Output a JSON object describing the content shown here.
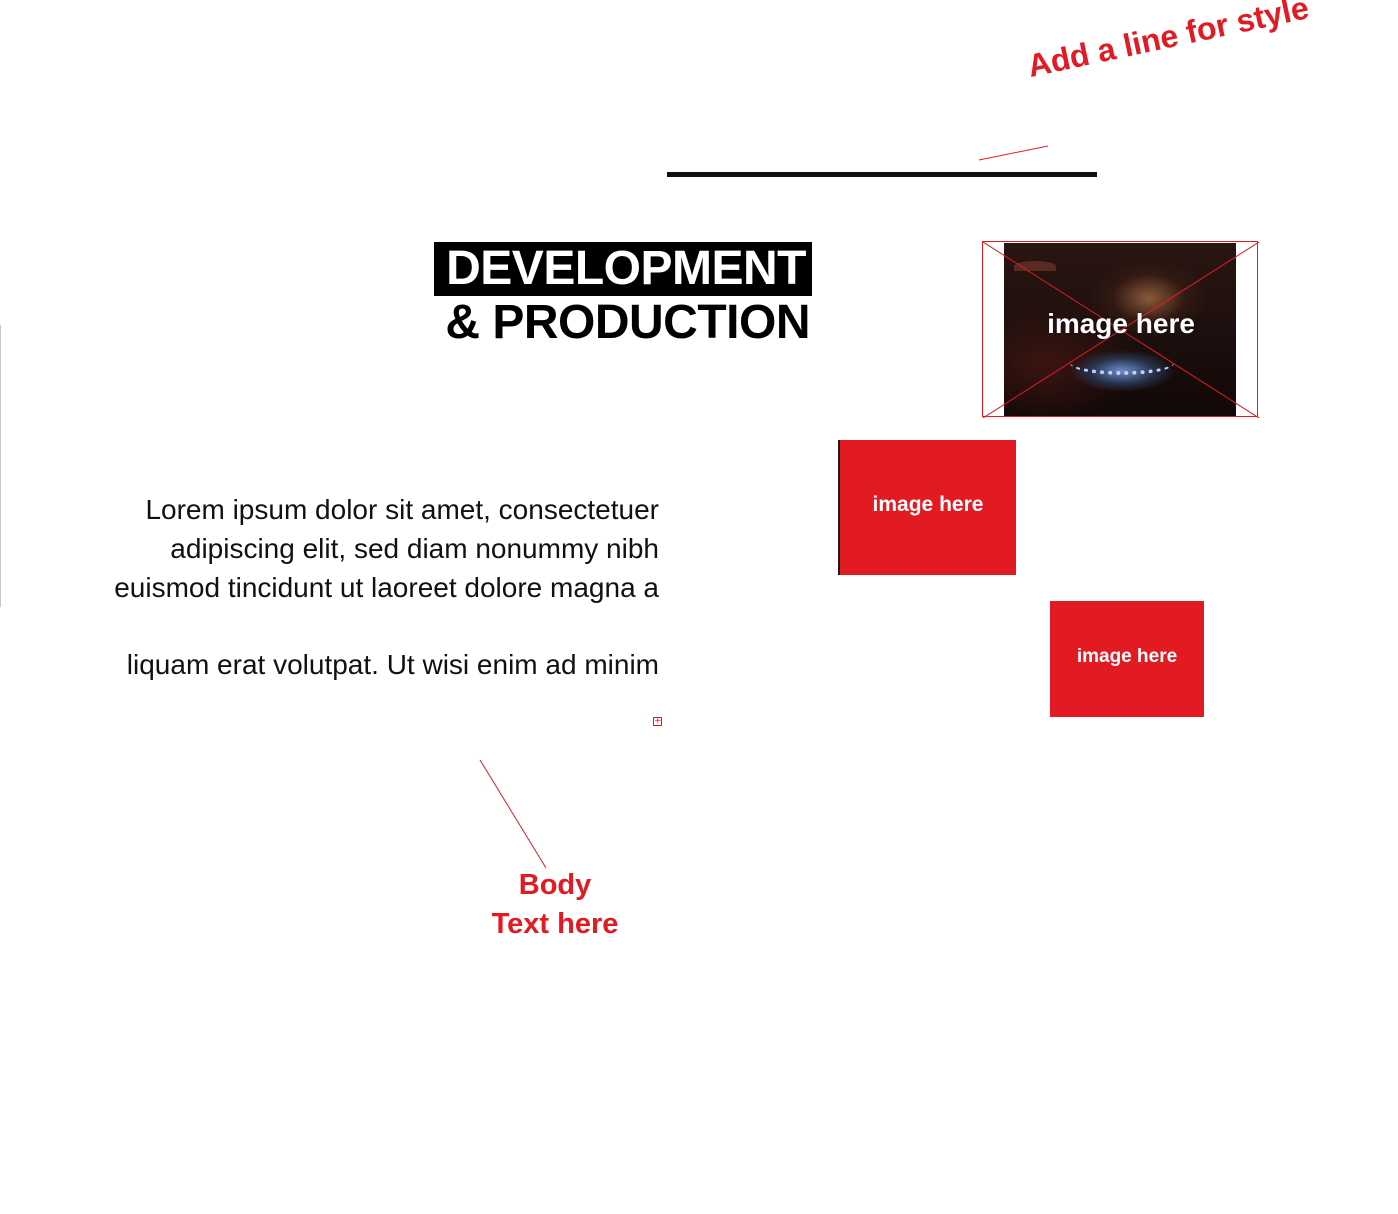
{
  "annotations": {
    "line_note": "Add a line for style",
    "body_note_line1": "Body",
    "body_note_line2": "Text here"
  },
  "headline": {
    "line1": "DEVELOPMENT",
    "line2": "& PRODUCTION"
  },
  "body": {
    "paragraph1": "Lorem ipsum dolor sit amet, consectetuer adipiscing elit, sed diam nonummy nibh euismod tincidunt ut laoreet dolore magna a",
    "paragraph2": "liquam erat volutpat. Ut wisi enim ad minim"
  },
  "images": {
    "photo_label": "image here",
    "box1_label": "image here",
    "box2_label": "image here"
  },
  "colors": {
    "accent": "#e21b23",
    "ink": "#111111",
    "headline_bg": "#000000"
  }
}
